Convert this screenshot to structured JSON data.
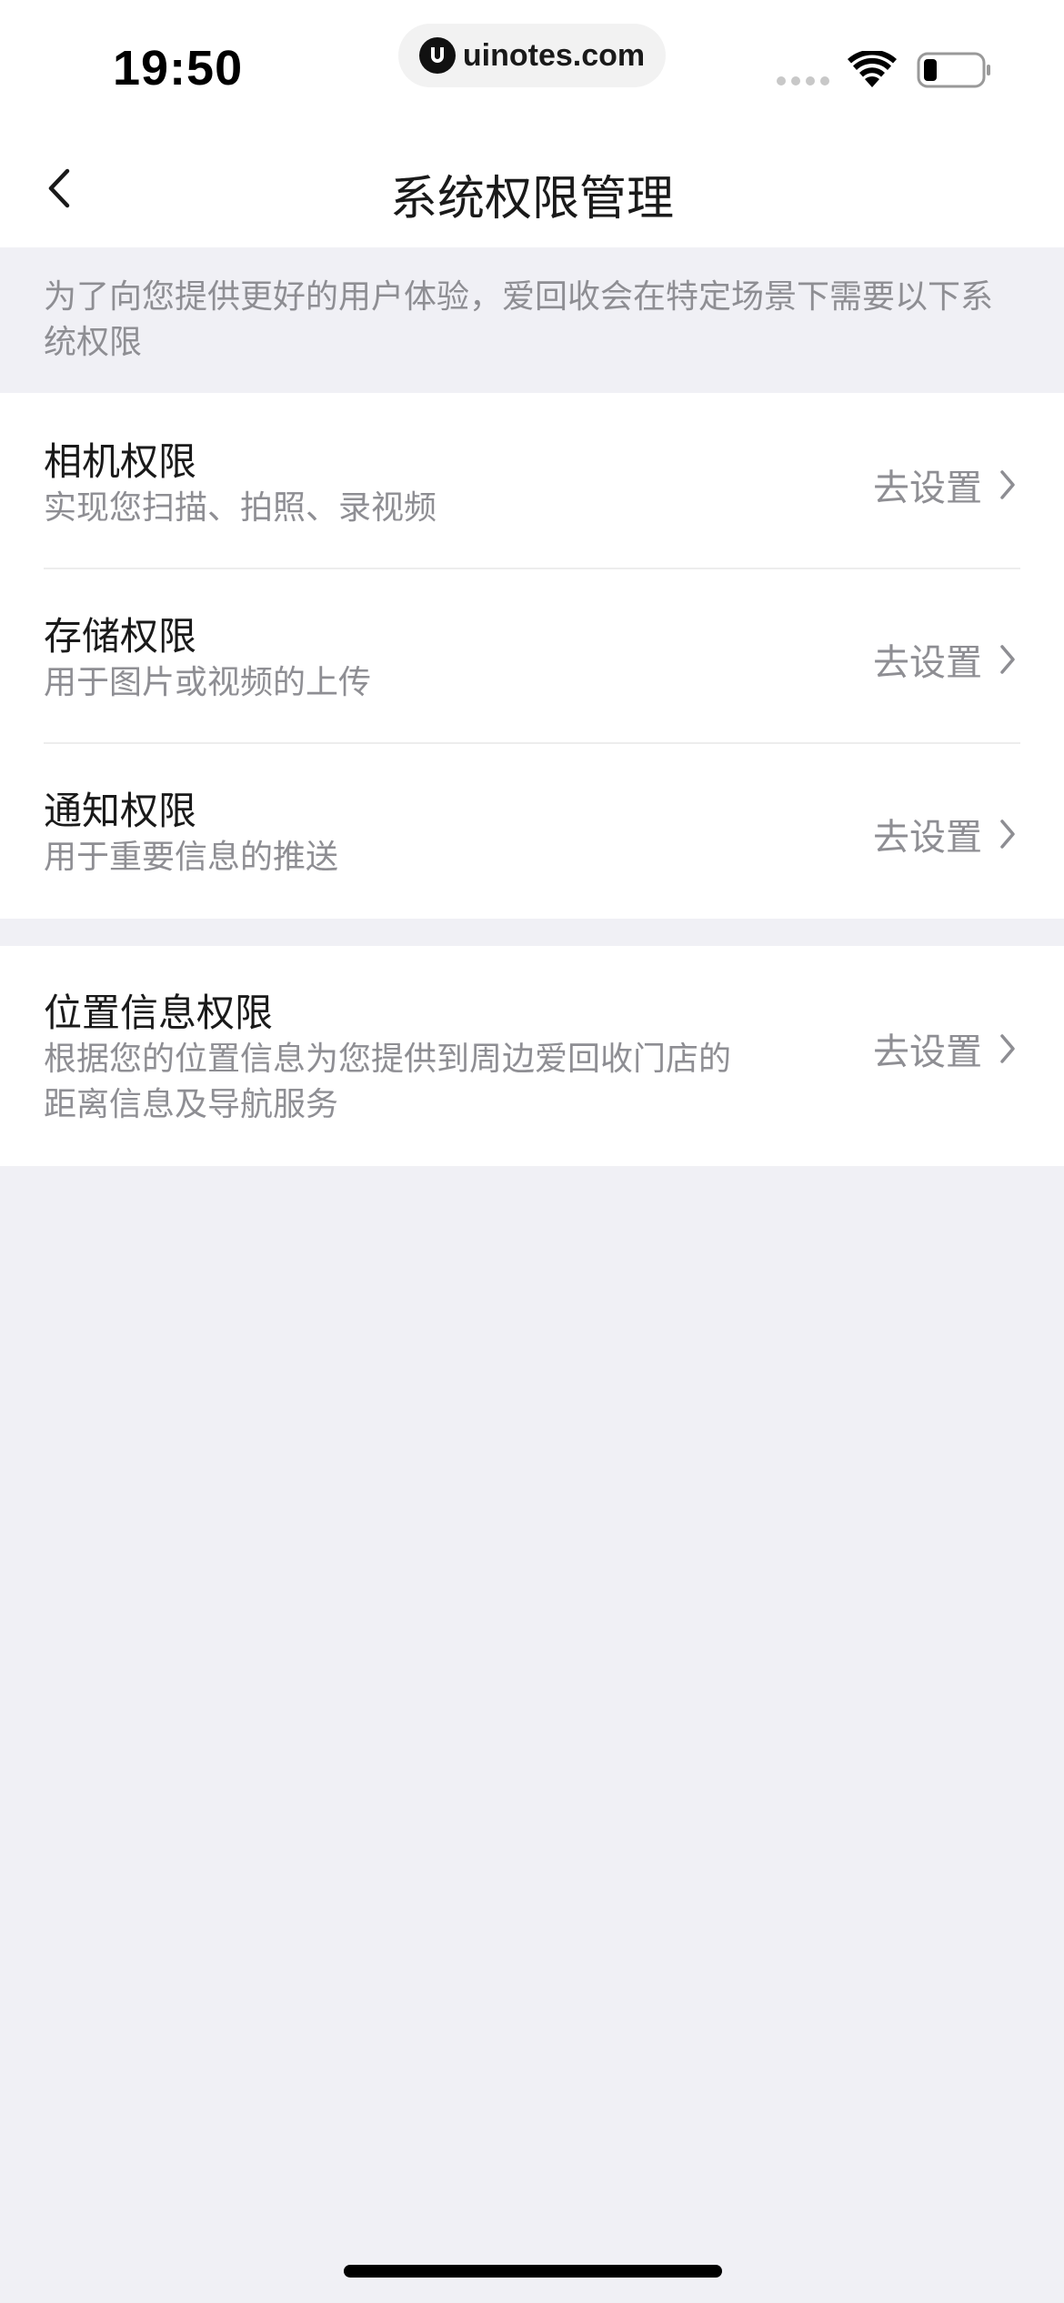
{
  "status_bar": {
    "time": "19:50",
    "url": "uinotes.com"
  },
  "nav": {
    "title": "系统权限管理"
  },
  "intro": {
    "text": "为了向您提供更好的用户体验，爱回收会在特定场景下需要以下系统权限"
  },
  "permissions": [
    {
      "title": "相机权限",
      "desc": "实现您扫描、拍照、录视频",
      "action": "去设置"
    },
    {
      "title": "存储权限",
      "desc": "用于图片或视频的上传",
      "action": "去设置"
    },
    {
      "title": "通知权限",
      "desc": "用于重要信息的推送",
      "action": "去设置"
    },
    {
      "title": "位置信息权限",
      "desc": "根据您的位置信息为您提供到周边爱回收门店的距离信息及导航服务",
      "action": "去设置"
    }
  ],
  "icons": {
    "back": "chevron-left-icon",
    "row_arrow": "chevron-right-icon",
    "wifi": "wifi-icon",
    "battery": "battery-icon",
    "signal": "cellular-signal-icon"
  },
  "colors": {
    "background": "#f0f0f5",
    "card": "#ffffff",
    "title_text": "#1a1a1a",
    "secondary_text": "#8e8e93",
    "divider": "#ededed"
  }
}
